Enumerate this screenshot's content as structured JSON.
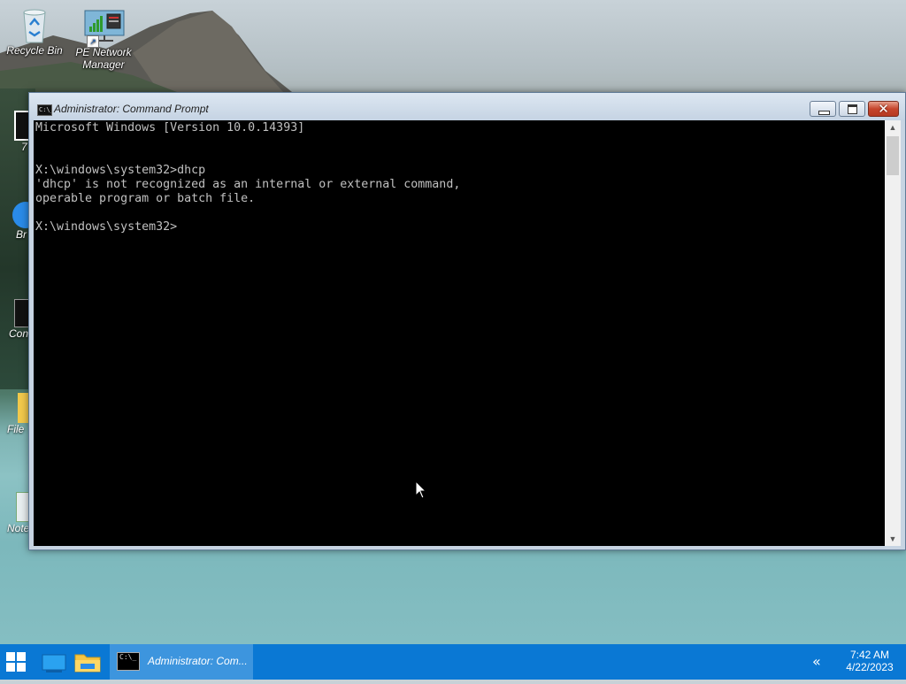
{
  "desktop": {
    "icons": [
      {
        "label": "Recycle Bin",
        "icon": "recycle-bin-icon"
      },
      {
        "label": "PE Network Manager",
        "icon": "network-manager-icon"
      }
    ],
    "partial_icons": [
      {
        "label": "7",
        "icon": "app-icon"
      },
      {
        "label": "Br",
        "icon": "browser-icon"
      },
      {
        "label": "Con",
        "icon": "console-icon"
      },
      {
        "label": "File",
        "icon": "folder-icon"
      },
      {
        "label": "Note",
        "icon": "notepad-icon"
      }
    ]
  },
  "window": {
    "title": "Administrator: Command Prompt",
    "title_icon": "C:\\_",
    "console_lines": [
      "Microsoft Windows [Version 10.0.14393]",
      "",
      "",
      "X:\\windows\\system32>dhcp",
      "'dhcp' is not recognized as an internal or external command,",
      "operable program or batch file.",
      "",
      "X:\\windows\\system32>"
    ]
  },
  "taskbar": {
    "task_label": "Administrator: Com...",
    "task_icon": "C:\\_",
    "overflow_glyph": "«",
    "time": "7:42 AM",
    "date": "4/22/2023",
    "accent": "#0a78d4"
  }
}
